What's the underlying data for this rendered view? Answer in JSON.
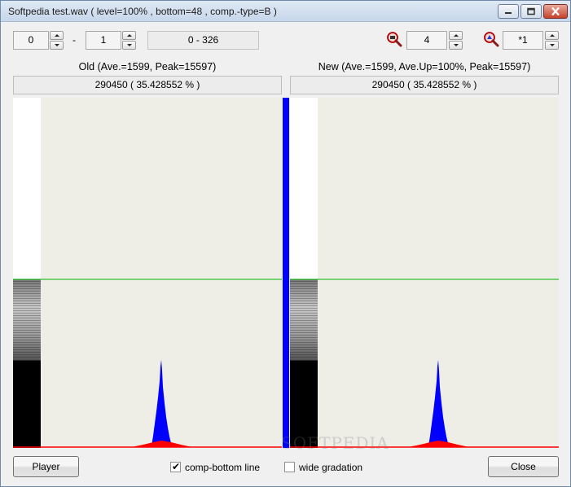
{
  "window": {
    "title": "Softpedia test.wav ( level=100% , bottom=48 , comp.-type=B )"
  },
  "toolbar": {
    "from_value": "0",
    "dash": "-",
    "to_value": "1",
    "range_display": "0 - 326",
    "zoom_value": "4",
    "scale_value": "*1"
  },
  "panels": {
    "old": {
      "title": "Old  (Ave.=1599, Peak=15597)",
      "info": "290450 ( 35.428552 % )"
    },
    "new": {
      "title": "New  (Ave.=1599, Ave.Up=100%, Peak=15597)",
      "info": "290450 ( 35.428552 % )"
    }
  },
  "bottom": {
    "player_label": "Player",
    "comp_bottom_label": "comp-bottom line",
    "comp_bottom_checked": true,
    "wide_gradation_label": "wide gradation",
    "wide_gradation_checked": false,
    "close_label": "Close"
  },
  "colors": {
    "histogram_blue": "#0000ff",
    "histogram_red": "#ff0000",
    "threshold_line": "#00b400",
    "plot_background": "#efeee6",
    "divider_blue": "#0000ff"
  },
  "icons": {
    "zoom": "magnifier-zoom-icon",
    "scale": "magnifier-scale-icon"
  },
  "watermark": "SOFTPEDIA"
}
